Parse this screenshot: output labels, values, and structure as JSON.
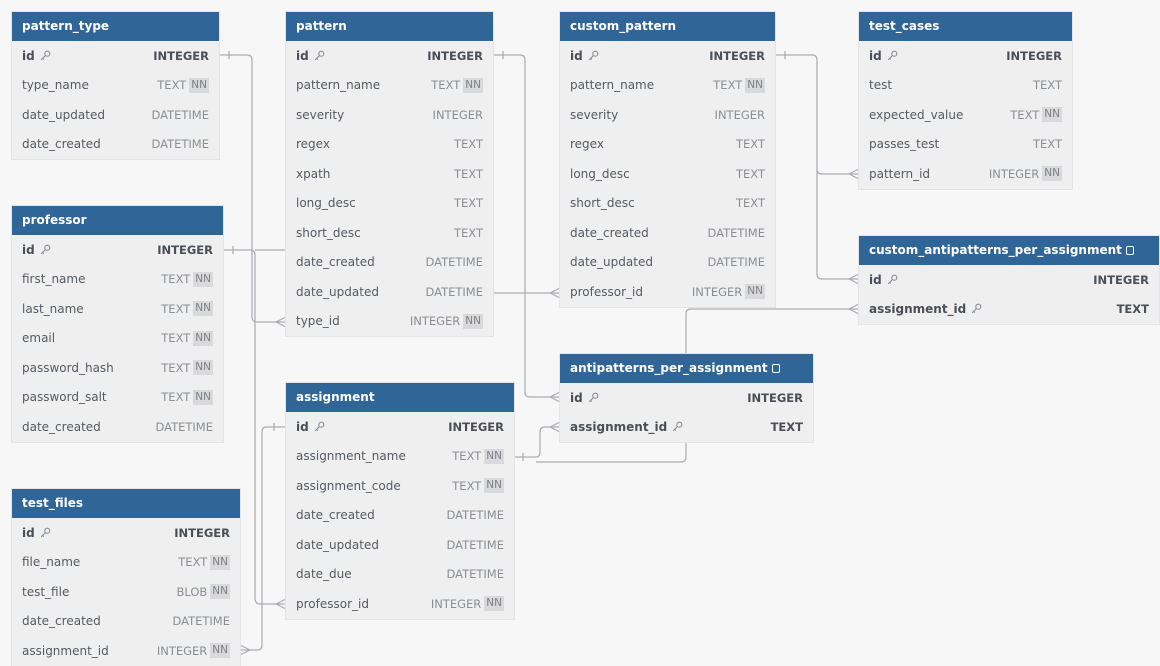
{
  "colors": {
    "header": "#2f6597",
    "body": "#efeff0",
    "line": "#a9abae",
    "background": "#f7f7f8"
  },
  "tables": {
    "pattern_type": {
      "name": "pattern_type",
      "has_note": false,
      "fields": [
        {
          "name": "id",
          "type": "INTEGER",
          "nn": false,
          "pk": true,
          "key_icon": "key-icon"
        },
        {
          "name": "type_name",
          "type": "TEXT",
          "nn": true
        },
        {
          "name": "date_updated",
          "type": "DATETIME",
          "nn": false
        },
        {
          "name": "date_created",
          "type": "DATETIME",
          "nn": false
        }
      ]
    },
    "professor": {
      "name": "professor",
      "has_note": false,
      "fields": [
        {
          "name": "id",
          "type": "INTEGER",
          "nn": false,
          "pk": true,
          "key_icon": "key-icon"
        },
        {
          "name": "first_name",
          "type": "TEXT",
          "nn": true
        },
        {
          "name": "last_name",
          "type": "TEXT",
          "nn": true
        },
        {
          "name": "email",
          "type": "TEXT",
          "nn": true
        },
        {
          "name": "password_hash",
          "type": "TEXT",
          "nn": true
        },
        {
          "name": "password_salt",
          "type": "TEXT",
          "nn": true
        },
        {
          "name": "date_created",
          "type": "DATETIME",
          "nn": false
        }
      ]
    },
    "test_files": {
      "name": "test_files",
      "has_note": false,
      "fields": [
        {
          "name": "id",
          "type": "INTEGER",
          "nn": false,
          "pk": true,
          "key_icon": "key-icon"
        },
        {
          "name": "file_name",
          "type": "TEXT",
          "nn": true
        },
        {
          "name": "test_file",
          "type": "BLOB",
          "nn": true
        },
        {
          "name": "date_created",
          "type": "DATETIME",
          "nn": false
        },
        {
          "name": "assignment_id",
          "type": "INTEGER",
          "nn": true
        }
      ]
    },
    "pattern": {
      "name": "pattern",
      "has_note": false,
      "fields": [
        {
          "name": "id",
          "type": "INTEGER",
          "nn": false,
          "pk": true,
          "key_icon": "key-icon"
        },
        {
          "name": "pattern_name",
          "type": "TEXT",
          "nn": true
        },
        {
          "name": "severity",
          "type": "INTEGER",
          "nn": false
        },
        {
          "name": "regex",
          "type": "TEXT",
          "nn": false
        },
        {
          "name": "xpath",
          "type": "TEXT",
          "nn": false
        },
        {
          "name": "long_desc",
          "type": "TEXT",
          "nn": false
        },
        {
          "name": "short_desc",
          "type": "TEXT",
          "nn": false
        },
        {
          "name": "date_created",
          "type": "DATETIME",
          "nn": false
        },
        {
          "name": "date_updated",
          "type": "DATETIME",
          "nn": false
        },
        {
          "name": "type_id",
          "type": "INTEGER",
          "nn": true
        }
      ]
    },
    "assignment": {
      "name": "assignment",
      "has_note": false,
      "fields": [
        {
          "name": "id",
          "type": "INTEGER",
          "nn": false,
          "pk": true,
          "key_icon": "key-icon"
        },
        {
          "name": "assignment_name",
          "type": "TEXT",
          "nn": true
        },
        {
          "name": "assignment_code",
          "type": "TEXT",
          "nn": true
        },
        {
          "name": "date_created",
          "type": "DATETIME",
          "nn": false
        },
        {
          "name": "date_updated",
          "type": "DATETIME",
          "nn": false
        },
        {
          "name": "date_due",
          "type": "DATETIME",
          "nn": false
        },
        {
          "name": "professor_id",
          "type": "INTEGER",
          "nn": true
        }
      ]
    },
    "custom_pattern": {
      "name": "custom_pattern",
      "has_note": false,
      "fields": [
        {
          "name": "id",
          "type": "INTEGER",
          "nn": false,
          "pk": true,
          "key_icon": "key-icon"
        },
        {
          "name": "pattern_name",
          "type": "TEXT",
          "nn": true
        },
        {
          "name": "severity",
          "type": "INTEGER",
          "nn": false
        },
        {
          "name": "regex",
          "type": "TEXT",
          "nn": false
        },
        {
          "name": "long_desc",
          "type": "TEXT",
          "nn": false
        },
        {
          "name": "short_desc",
          "type": "TEXT",
          "nn": false
        },
        {
          "name": "date_created",
          "type": "DATETIME",
          "nn": false
        },
        {
          "name": "date_updated",
          "type": "DATETIME",
          "nn": false
        },
        {
          "name": "professor_id",
          "type": "INTEGER",
          "nn": true
        }
      ]
    },
    "antipatterns_per_assignment": {
      "name": "antipatterns_per_assignment",
      "has_note": true,
      "note_icon": "note-icon",
      "fields": [
        {
          "name": "id",
          "type": "INTEGER",
          "nn": false,
          "pk": true,
          "key_icon": "key-icon"
        },
        {
          "name": "assignment_id",
          "type": "TEXT",
          "nn": false,
          "pk": true,
          "key_icon": "key-icon"
        }
      ]
    },
    "test_cases": {
      "name": "test_cases",
      "has_note": false,
      "fields": [
        {
          "name": "id",
          "type": "INTEGER",
          "nn": false,
          "pk": true,
          "key_icon": "key-icon"
        },
        {
          "name": "test",
          "type": "TEXT",
          "nn": false
        },
        {
          "name": "expected_value",
          "type": "TEXT",
          "nn": true
        },
        {
          "name": "passes_test",
          "type": "TEXT",
          "nn": false
        },
        {
          "name": "pattern_id",
          "type": "INTEGER",
          "nn": true
        }
      ]
    },
    "custom_antipatterns_per_assignment": {
      "name": "custom_antipatterns_per_assignment",
      "has_note": true,
      "note_icon": "note-icon",
      "fields": [
        {
          "name": "id",
          "type": "INTEGER",
          "nn": false,
          "pk": true,
          "key_icon": "key-icon"
        },
        {
          "name": "assignment_id",
          "type": "TEXT",
          "nn": false,
          "pk": true,
          "key_icon": "key-icon"
        }
      ]
    }
  },
  "nn_label": "NN",
  "relationships": [
    {
      "from": "pattern_type.id",
      "to": "pattern.type_id",
      "cardinality": "one-to-many"
    },
    {
      "from": "professor.id",
      "to": "assignment.professor_id",
      "cardinality": "one-to-many"
    },
    {
      "from": "assignment.id",
      "to": "test_files.assignment_id",
      "cardinality": "one-to-many"
    },
    {
      "from": "pattern.id",
      "to": "antipatterns_per_assignment.id",
      "cardinality": "one-to-many"
    },
    {
      "from": "assignment.assignment_name",
      "to": "antipatterns_per_assignment.assignment_id",
      "cardinality": "one-to-many"
    },
    {
      "from": "pattern.date_updated",
      "to": "custom_pattern.professor_id",
      "cardinality": "one-to-many"
    },
    {
      "from": "custom_pattern.id",
      "to": "test_cases.pattern_id",
      "cardinality": "one-to-many"
    },
    {
      "from": "custom_pattern.id",
      "to": "custom_antipatterns_per_assignment.id",
      "cardinality": "one-to-many"
    },
    {
      "from": "antipatterns_per_assignment.assignment_id",
      "to": "custom_antipatterns_per_assignment.assignment_id",
      "cardinality": "many-to-one"
    }
  ]
}
